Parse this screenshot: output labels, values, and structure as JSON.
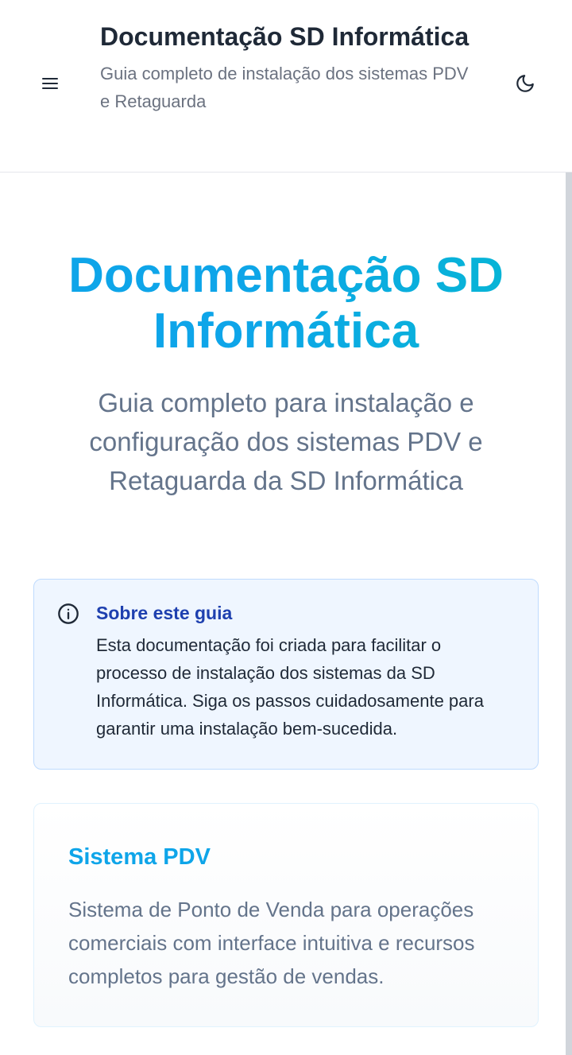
{
  "header": {
    "title": "Documentação SD Informática",
    "subtitle": "Guia completo de instalação dos sistemas PDV e Retaguarda",
    "menu_icon": "hamburger-menu-icon",
    "theme_icon": "moon-icon"
  },
  "hero": {
    "title": "Documentação SD Informática",
    "subtitle": "Guia completo para instalação e configuração dos sistemas PDV e Retaguarda da SD Informática"
  },
  "info": {
    "icon": "info-circle-icon",
    "title": "Sobre este guia",
    "text": "Esta documentação foi criada para facilitar o processo de instalação dos sistemas da SD Informática. Siga os passos cuidadosamente para garantir uma instalação bem-sucedida."
  },
  "cards": [
    {
      "title": "Sistema PDV",
      "text": "Sistema de Ponto de Venda para operações comerciais com interface intuitiva e recursos completos para gestão de vendas."
    }
  ],
  "colors": {
    "accent": "#0ea5e9",
    "info_bg": "#eff6ff",
    "info_title": "#1e40af",
    "muted_text": "#64748b"
  }
}
